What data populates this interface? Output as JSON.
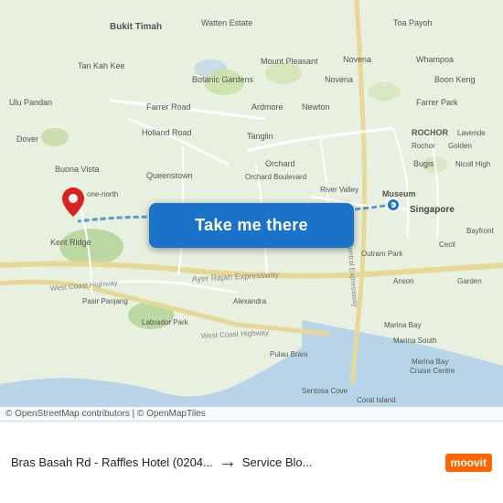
{
  "map": {
    "attribution": "© OpenStreetMap contributors | © OpenMapTiles",
    "button_label": "Take me there",
    "pin_color": "#e02020"
  },
  "bottom_bar": {
    "from_label": "Bras Basah Rd - Raffles Hotel (0204...",
    "arrow_symbol": "→",
    "to_label": "Service Blo...",
    "moovit_label": "moovit"
  },
  "map_labels": {
    "bukit_timah": "Bukit Timah",
    "watten_estate": "Watten Estate",
    "toa_payoh": "Toa Payoh",
    "tan_kah_kee": "Tan Kah Kee",
    "mount_pleasant": "Mount Pleasant",
    "novena": "Novena",
    "whampoa": "Whampoa",
    "botanic_gardens": "Botanic Gardens",
    "novena2": "Novena",
    "boon_keng": "Boon Keng",
    "ulu_pandan": "Ulu Pandan",
    "farrer_road": "Farrer Road",
    "ardmore": "Ardmore",
    "newton": "Newton",
    "farrer_park": "Farrer Park",
    "dover": "Dover",
    "holland_road": "Holland Road",
    "tanglin": "Tanglin",
    "rochor": "ROCHOR",
    "rochor2": "Rochor",
    "lavendel": "Lavende",
    "golden": "Golden",
    "buona_vista": "Buona Vista",
    "orchard": "Orchard",
    "orchard_blvd": "Orchard Boulevard",
    "queenstown": "Queenstown",
    "bugis": "Bugis",
    "river_valley": "River Valley",
    "nicoll": "Nicoll High",
    "kent_ridge": "Kent Ridge",
    "museum": "Museum",
    "singapore": "Singapore",
    "one_north": "one-north",
    "west_coast_hwy": "West Coast Highway",
    "ayer_rajah": "Ayer Rajah Expressway",
    "central_expressway": "Central Expressway",
    "outram_park": "Outram Park",
    "anson": "Anson",
    "cecil": "Cecil",
    "bayfront": "Bayfront",
    "alexandra": "Alexandra",
    "pasir_panjang": "Pasir Panjang",
    "labrador_park": "Labrador Park",
    "marina_bay": "Marina Bay",
    "marina_south": "Marina South",
    "marina_bay_cruise": "Marina Bay Cruise Centre",
    "pulau_brani": "Pulau Brani",
    "sentosa_cove": "Sentosa Cove",
    "coral_island": "Coral Island"
  }
}
